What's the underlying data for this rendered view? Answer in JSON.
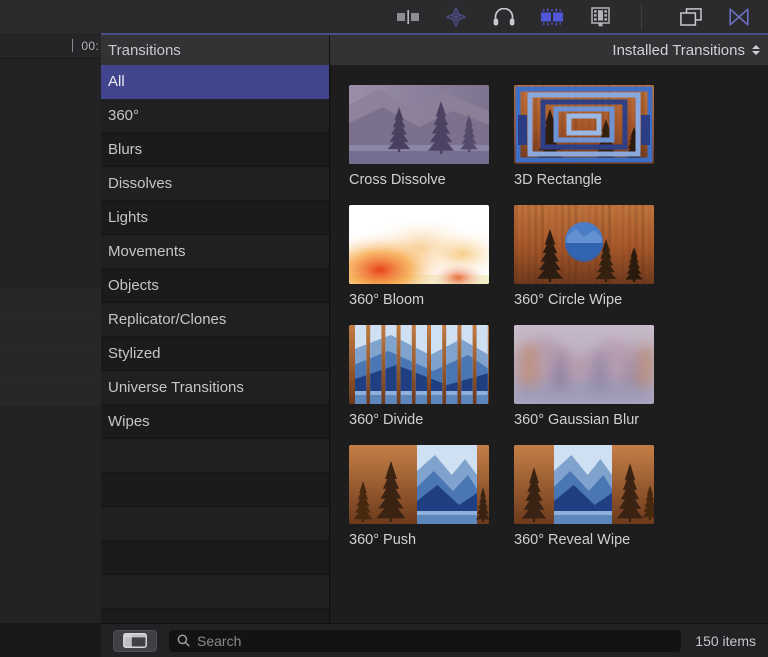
{
  "toolbar": {
    "buttons": [
      {
        "name": "crop-transform-icon",
        "label": "Crop/Transform",
        "color": "#9a9a9e",
        "active": false
      },
      {
        "name": "color-board-icon",
        "label": "Color Board",
        "color": "#4a4a80",
        "active": false
      },
      {
        "name": "headphones-icon",
        "label": "Audio Enhancements",
        "color": "#c8c8cc",
        "active": false
      },
      {
        "name": "transitions-browser-icon",
        "label": "Transitions Browser",
        "color": "#5157d8",
        "active": true
      },
      {
        "name": "filmstrip-icon",
        "label": "Titles and Generators",
        "color": "#b4b4b8",
        "active": false
      },
      {
        "name": "window-layers-icon",
        "label": "Show/Hide Inspector",
        "color": "#c8c8cc",
        "active": false
      },
      {
        "name": "bowtie-transition-icon",
        "label": "Transitions",
        "color": "#6a6fc0",
        "active": false
      }
    ]
  },
  "timeline": {
    "timecode": "00:"
  },
  "browser": {
    "sidebar_title": "Transitions",
    "popup_label": "Installed Transitions",
    "categories": [
      {
        "label": "All",
        "selected": true
      },
      {
        "label": "360°",
        "selected": false
      },
      {
        "label": "Blurs",
        "selected": false
      },
      {
        "label": "Dissolves",
        "selected": false
      },
      {
        "label": "Lights",
        "selected": false
      },
      {
        "label": "Movements",
        "selected": false
      },
      {
        "label": "Objects",
        "selected": false
      },
      {
        "label": "Replicator/Clones",
        "selected": false
      },
      {
        "label": "Stylized",
        "selected": false
      },
      {
        "label": "Universe Transitions",
        "selected": false
      },
      {
        "label": "Wipes",
        "selected": false
      }
    ],
    "items": [
      {
        "label": "Cross Dissolve",
        "thumb": "cross-dissolve"
      },
      {
        "label": "3D Rectangle",
        "thumb": "rect-3d"
      },
      {
        "label": "360° Bloom",
        "thumb": "bloom"
      },
      {
        "label": "360° Circle Wipe",
        "thumb": "circle-wipe"
      },
      {
        "label": "360° Divide",
        "thumb": "divide"
      },
      {
        "label": "360° Gaussian Blur",
        "thumb": "gaussian-blur"
      },
      {
        "label": "360° Push",
        "thumb": "push"
      },
      {
        "label": "360° Reveal Wipe",
        "thumb": "reveal-wipe"
      }
    ]
  },
  "bottom": {
    "search_placeholder": "Search",
    "search_value": "",
    "item_count": "150 items"
  },
  "colors": {
    "selection_blue": "#41458e",
    "accent_blue": "#5157d8",
    "panel_bg": "#1d1d1d",
    "header_bg": "#333335",
    "toolbar_bg": "#2b2b2d"
  }
}
